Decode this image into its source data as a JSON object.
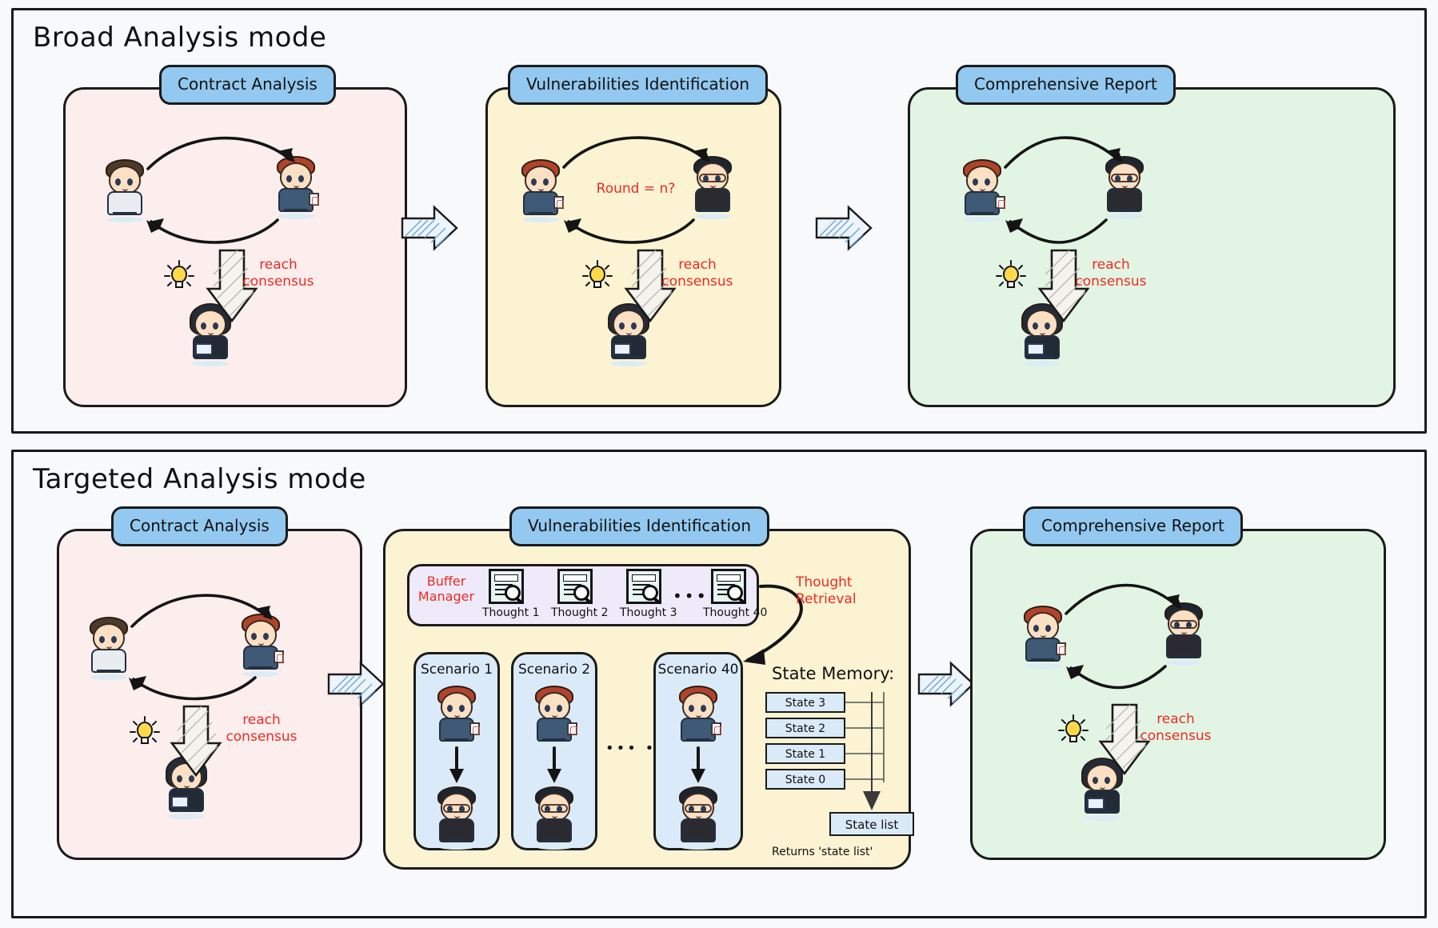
{
  "modes": [
    {
      "key": "broad",
      "title": "Broad Analysis mode",
      "stages": [
        {
          "key": "contract_analysis",
          "label": "Contract Analysis",
          "color": "#fdeeee",
          "consensus_note": "reach\nconsensus",
          "round_note": null,
          "agents": [
            "developer",
            "auditor",
            "lead"
          ]
        },
        {
          "key": "vulnerabilities_identification",
          "label": "Vulnerabilities Identification",
          "color": "#fcf3d2",
          "consensus_note": "reach\nconsensus",
          "round_note": "Round = n?",
          "agents": [
            "auditor",
            "engineer",
            "lead"
          ]
        },
        {
          "key": "comprehensive_report",
          "label": "Comprehensive Report",
          "color": "#e2f5e4",
          "consensus_note": "reach\nconsensus",
          "round_note": null,
          "agents": [
            "auditor",
            "engineer",
            "lead"
          ]
        }
      ]
    },
    {
      "key": "targeted",
      "title": "Targeted Analysis mode",
      "stages": [
        {
          "key": "contract_analysis",
          "label": "Contract Analysis",
          "color": "#fdeeee",
          "consensus_note": "reach\nconsensus",
          "round_note": null,
          "agents": [
            "developer",
            "auditor",
            "lead"
          ]
        },
        {
          "key": "vulnerabilities_identification",
          "label": "Vulnerabilities Identification",
          "color": "#fcf3d2",
          "consensus_note": null,
          "round_note": null,
          "agents": []
        },
        {
          "key": "comprehensive_report",
          "label": "Comprehensive Report",
          "color": "#e2f5e4",
          "consensus_note": "reach\nconsensus",
          "round_note": null,
          "agents": [
            "auditor",
            "engineer",
            "lead"
          ]
        }
      ]
    }
  ],
  "buffer": {
    "manager_label": "Buffer\nManager",
    "thoughts": [
      {
        "label": "Thought 1"
      },
      {
        "label": "Thought 2"
      },
      {
        "label": "Thought 3"
      },
      {
        "label": "Thought 40"
      }
    ],
    "ellipsis_a": "•••",
    "ellipsis_b": "•••",
    "retrieval_note": "Thought\nRetrieval"
  },
  "scenarios": {
    "items": [
      {
        "label": "Scenario 1"
      },
      {
        "label": "Scenario 2"
      },
      {
        "label": "Scenario 40"
      }
    ],
    "ellipsis": "•••  •••"
  },
  "state_memory": {
    "title": "State Memory:",
    "cells": [
      "State 3",
      "State 2",
      "State 1",
      "State 0"
    ],
    "output_box": "State list",
    "returns_note": "Returns 'state list'"
  },
  "colors": {
    "stage_label_bg": "#93c9f0",
    "pink": "#fdeeee",
    "cream": "#fcf3d2",
    "green": "#e2f5e4",
    "buffer_bg": "#eeeaf9",
    "scenario_bg": "#daeaf8",
    "annotation_red": "#ee2a22",
    "outline": "#1b1b1b",
    "page_bg": "#f7f9fb"
  }
}
